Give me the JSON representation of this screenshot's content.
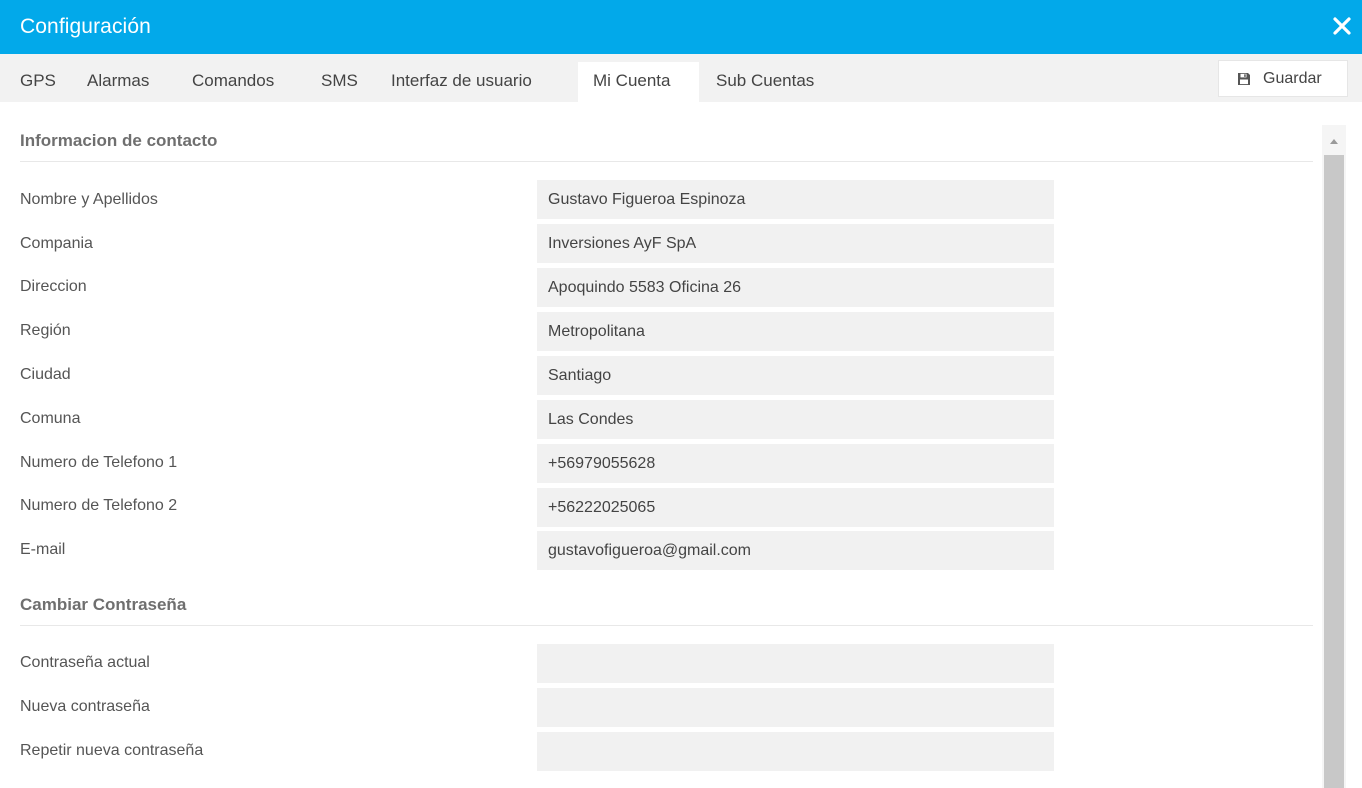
{
  "window": {
    "title": "Configuración",
    "accent_color": "#02a9ea",
    "close_icon": "close-icon"
  },
  "tabs": [
    {
      "label": "GPS",
      "active": false
    },
    {
      "label": "Alarmas",
      "active": false
    },
    {
      "label": "Comandos",
      "active": false
    },
    {
      "label": "SMS",
      "active": false
    },
    {
      "label": "Interfaz de usuario",
      "active": false
    },
    {
      "label": "Mi Cuenta",
      "active": true
    },
    {
      "label": "Sub Cuentas",
      "active": false
    }
  ],
  "toolbar": {
    "save_label": "Guardar",
    "save_icon": "floppy-disk-icon"
  },
  "contact": {
    "section_title": "Informacion de contacto",
    "fields": [
      {
        "label": "Nombre y Apellidos",
        "value": "Gustavo Figueroa Espinoza"
      },
      {
        "label": "Compania",
        "value": "Inversiones AyF SpA"
      },
      {
        "label": "Direccion",
        "value": "Apoquindo 5583 Oficina 26"
      },
      {
        "label": "Región",
        "value": "Metropolitana"
      },
      {
        "label": "Ciudad",
        "value": "Santiago"
      },
      {
        "label": "Comuna",
        "value": "Las Condes"
      },
      {
        "label": "Numero de Telefono 1",
        "value": "+56979055628"
      },
      {
        "label": "Numero de Telefono 2",
        "value": "+56222025065"
      },
      {
        "label": "E-mail",
        "value": "gustavofigueroa@gmail.com"
      }
    ]
  },
  "password": {
    "section_title": "Cambiar Contraseña",
    "fields": [
      {
        "label": "Contraseña actual",
        "value": ""
      },
      {
        "label": "Nueva contraseña",
        "value": ""
      },
      {
        "label": "Repetir nueva contraseña",
        "value": ""
      }
    ]
  }
}
